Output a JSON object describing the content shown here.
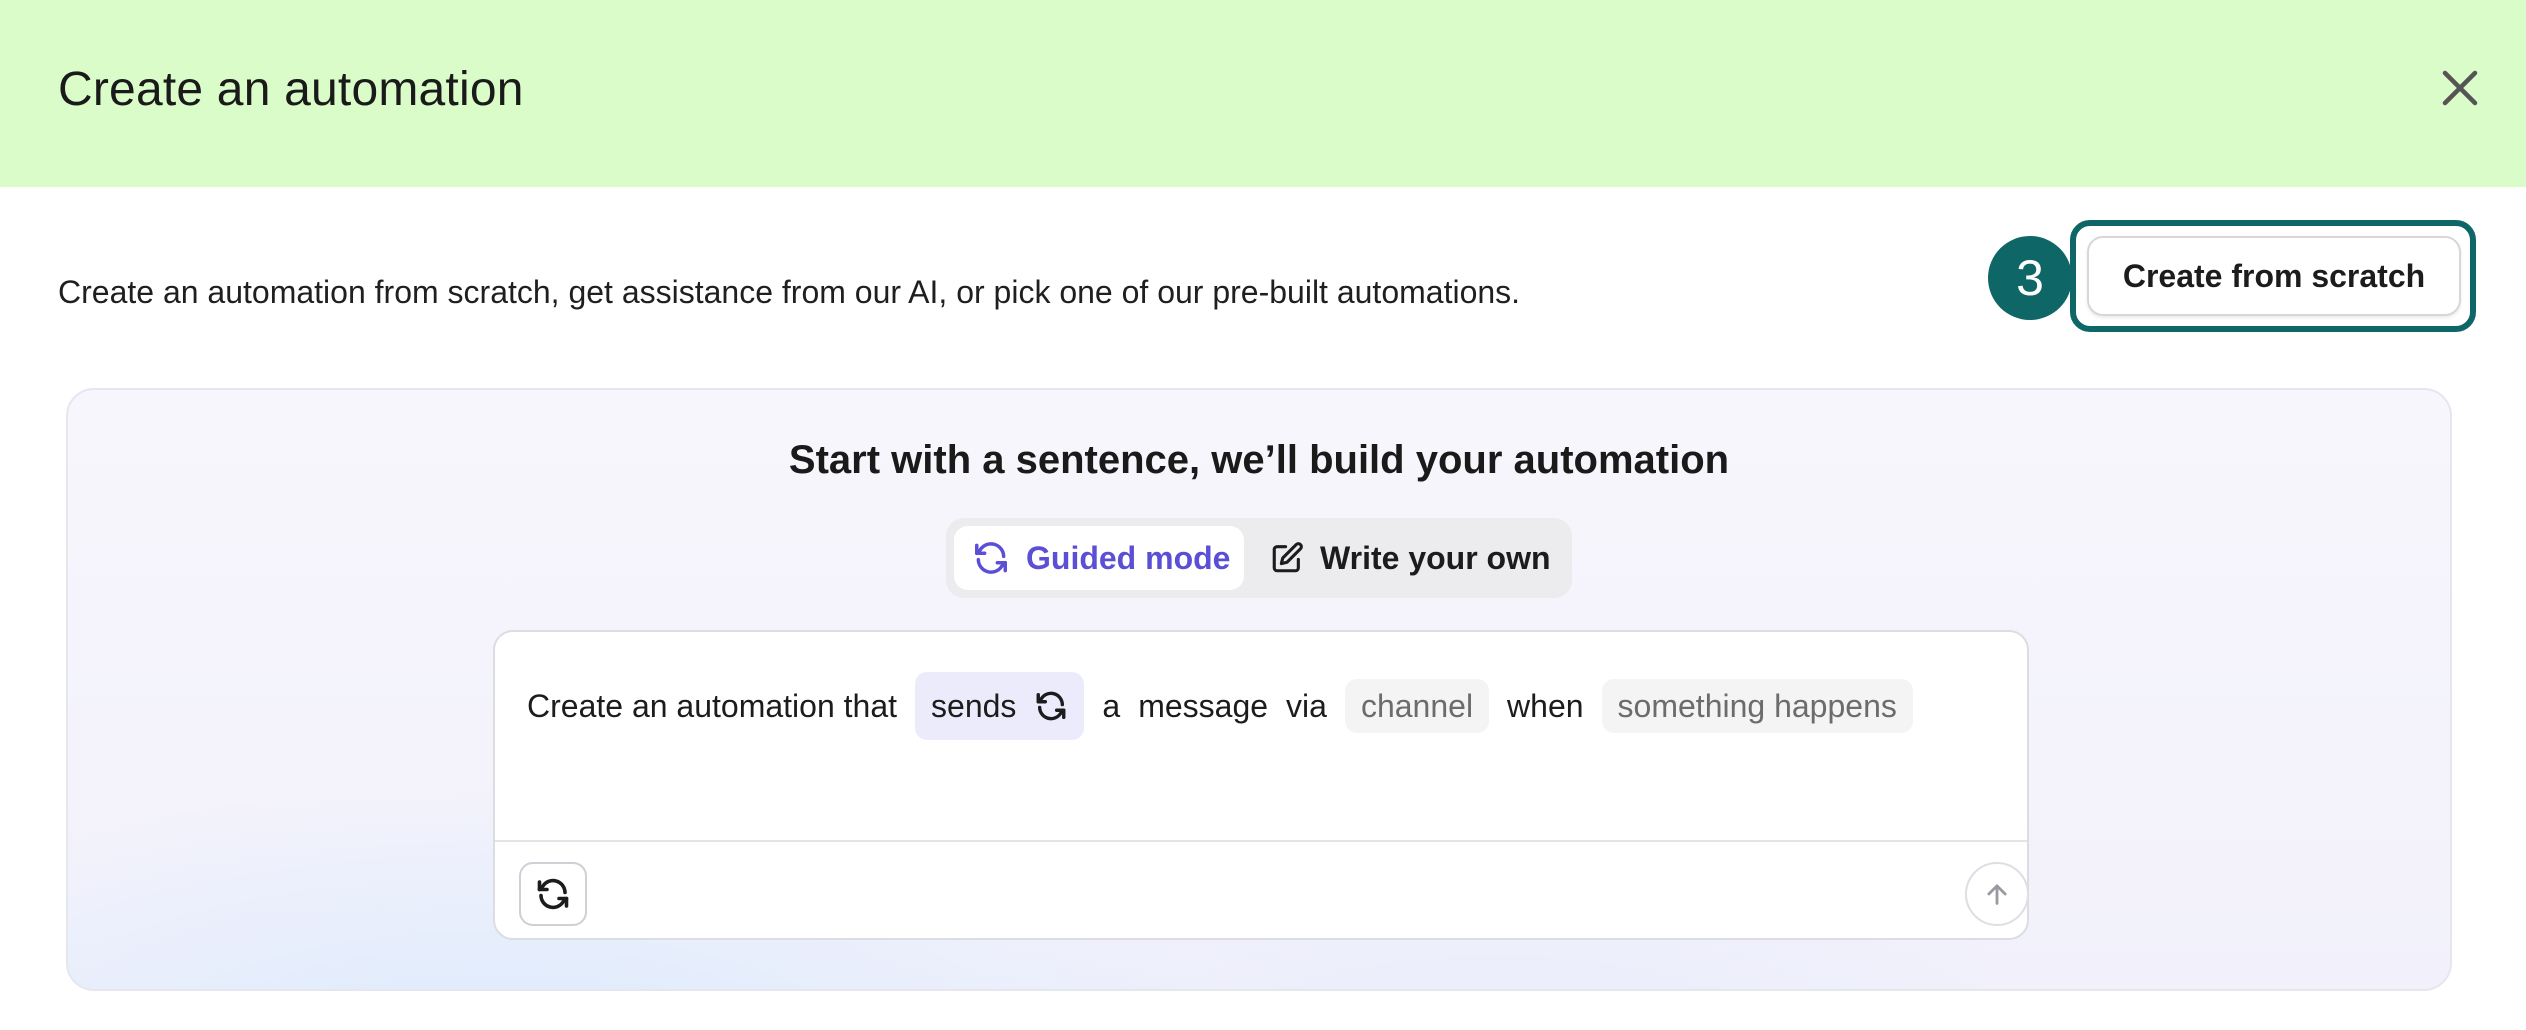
{
  "header": {
    "title": "Create an automation",
    "close_icon": "close-icon",
    "background": "#d9fcc8"
  },
  "intro": {
    "description": "Create an automation from scratch, get assistance from our AI, or pick one of our pre-built automations.",
    "step_number": "3",
    "create_from_scratch_label": "Create from scratch",
    "accent_color": "#0f6666"
  },
  "ai_builder": {
    "title": "Start with a sentence, we’ll build your automation",
    "modes": [
      {
        "label": "Guided mode",
        "icon": "refresh-icon",
        "active": true,
        "color": "#5b4fd6"
      },
      {
        "label": "Write your own",
        "icon": "edit-icon",
        "active": false
      }
    ],
    "sentence": {
      "prefix": "Create an automation that",
      "action_chip": "sends",
      "word_a": "a",
      "word_message": "message",
      "word_via": "via",
      "channel_placeholder": "channel",
      "word_when": "when",
      "trigger_placeholder": "something happens"
    },
    "footer": {
      "shuffle_icon": "refresh-icon",
      "send_icon": "arrow-up-icon"
    }
  }
}
